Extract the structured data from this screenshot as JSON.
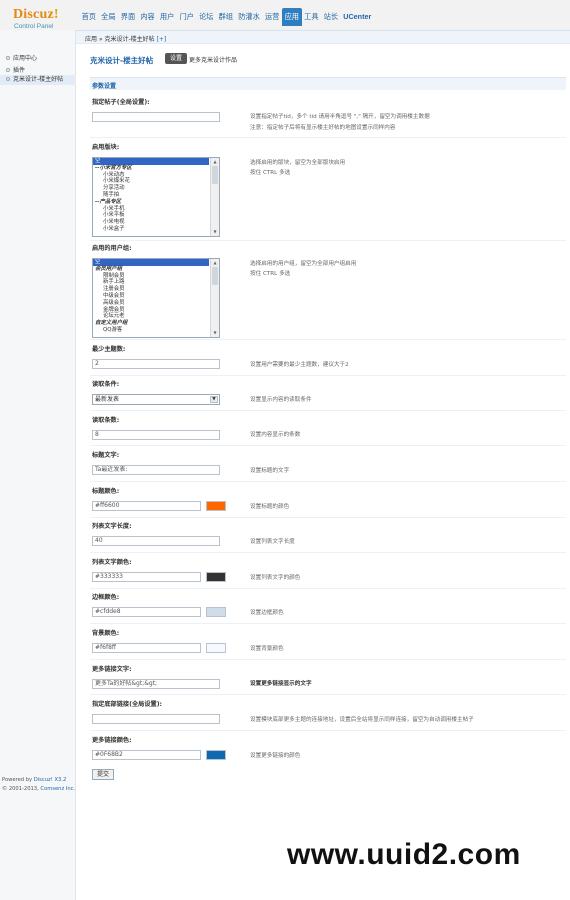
{
  "header": {
    "brand": "Discuz",
    "brand_mark": "!",
    "subtitle": "Control Panel",
    "nav": [
      "首页",
      "全局",
      "界面",
      "内容",
      "用户",
      "门户",
      "论坛",
      "群组",
      "防灌水",
      "运营",
      "应用",
      "工具",
      "站长",
      "UCenter"
    ],
    "active_nav": "应用"
  },
  "breadcrumb": {
    "path": "应用 » 克米设计-楼主好帖",
    "toggle": "[+]"
  },
  "sidebar": {
    "items": [
      "应用中心",
      "插件",
      "克米设计-楼主好帖"
    ],
    "footer_line1_prefix": "Powered by ",
    "footer_line1_brand": "Discuz! X3.2",
    "footer_line2_prefix": "© 2001-2013, ",
    "footer_line2_brand": "Comsenz Inc."
  },
  "main": {
    "title": "克米设计-楼主好帖",
    "settings_pill": "设置",
    "more_works": "更多克米设计作品",
    "section": "参数设置",
    "fields": {
      "tid_label": "指定帖子(全局设置):",
      "tid_value": "",
      "tid_hint1": "设置指定帖子tid，多个 tid 请用半角逗号 \",\" 隔开，留空为调用楼主数据",
      "tid_hint2": "注意：指定帖子后将有显示楼主好帖的地图设置示同样内容",
      "forums_label": "启用版块:",
      "forums_options": [
        {
          "text": "空",
          "type": "sel"
        },
        {
          "text": "--小米官方专区",
          "type": "grp"
        },
        {
          "text": "小米动态",
          "type": "ind"
        },
        {
          "text": "小米爆米花",
          "type": "ind"
        },
        {
          "text": "分享活动",
          "type": "ind"
        },
        {
          "text": "随手拍",
          "type": "ind"
        },
        {
          "text": "--产品专区",
          "type": "grp"
        },
        {
          "text": "小米手机",
          "type": "ind"
        },
        {
          "text": "小米平板",
          "type": "ind"
        },
        {
          "text": "小米电视",
          "type": "ind"
        },
        {
          "text": "小米盒子",
          "type": "ind"
        }
      ],
      "forums_hint1": "选择启用的版块，留空为全部版块启用",
      "forums_hint2": "按住 CTRL 多选",
      "groups_label": "启用的用户组:",
      "groups_options": [
        {
          "text": "空",
          "type": "sel"
        },
        {
          "text": "会员用户组",
          "type": "grp"
        },
        {
          "text": "限制会员",
          "type": "ind"
        },
        {
          "text": "新手上路",
          "type": "ind"
        },
        {
          "text": "注册会员",
          "type": "ind"
        },
        {
          "text": "中级会员",
          "type": "ind"
        },
        {
          "text": "高级会员",
          "type": "ind"
        },
        {
          "text": "金牌会员",
          "type": "ind"
        },
        {
          "text": "论坛元老",
          "type": "ind"
        },
        {
          "text": "自定义用户组",
          "type": "grp"
        },
        {
          "text": "QQ游客",
          "type": "ind"
        }
      ],
      "groups_hint1": "选择启用的用户组，留空为全部用户组启用",
      "groups_hint2": "按住 CTRL 多选",
      "min_topics_label": "最少主题数:",
      "min_topics_value": "2",
      "min_topics_hint": "设置用户需要的最少主题数，建议大于2",
      "read_cond_label": "读取条件:",
      "read_cond_value": "最新发表",
      "read_cond_hint": "设置显示内容的读取条件",
      "read_count_label": "读取条数:",
      "read_count_value": "8",
      "read_count_hint": "设置内容显示的条数",
      "title_text_label": "标题文字:",
      "title_text_value": "Ta最近发表:",
      "title_text_hint": "设置标题的文字",
      "title_color_label": "标题颜色:",
      "title_color_value": "#ff6600",
      "title_color_hint": "设置标题的颜色",
      "list_len_label": "列表文字长度:",
      "list_len_value": "40",
      "list_len_hint": "设置列表文字长度",
      "list_color_label": "列表文字颜色:",
      "list_color_value": "#333333",
      "list_color_hint": "设置列表文字的颜色",
      "border_color_label": "边框颜色:",
      "border_color_value": "#cfdde8",
      "border_color_hint": "设置边框颜色",
      "bg_color_label": "背景颜色:",
      "bg_color_value": "#f6f8ff",
      "bg_color_hint": "设置背景颜色",
      "more_text_label": "更多链接文字:",
      "more_text_value": "更多Ta的好帖&gt;&gt;",
      "more_text_hint": "设置更多链接显示的文字",
      "bottom_link_label": "指定底部链接(全局设置):",
      "bottom_link_value": "",
      "bottom_link_hint": "设置模块底部更多主题的连接地址，设置后全站将显示同样连接，留空为自动调用楼主帖子",
      "more_color_label": "更多链接颜色:",
      "more_color_value": "#0F68B2",
      "more_color_hint": "设置更多链接的颜色"
    },
    "submit": "提交"
  },
  "watermark": "www.uuid2.com",
  "colors": {
    "accent": "#2f7fc0",
    "brand": "#e38a0f",
    "swatch_title": "#ff6600",
    "swatch_list": "#333333",
    "swatch_border": "#cfdde8",
    "swatch_bg": "#f6f8ff",
    "swatch_more": "#0F68B2"
  }
}
